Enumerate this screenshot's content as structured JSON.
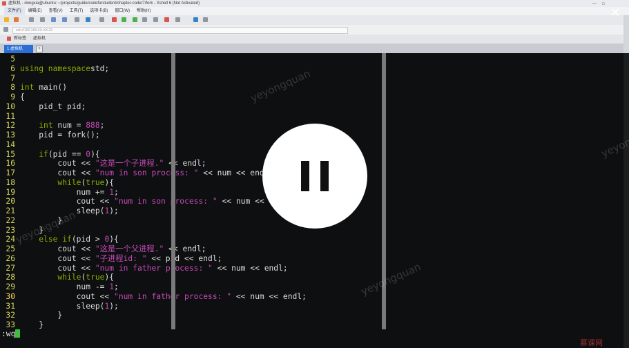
{
  "window": {
    "title": "虚拟机 - dongxia@ubuntu: ~/projects/guide/codeforstudent/chapter-code/7/fork - Xshell 6 (Not Activated)"
  },
  "menu": [
    "文件(F)",
    "编辑(E)",
    "查看(V)",
    "工具(T)",
    "选项卡(B)",
    "窗口(W)",
    "帮助(H)"
  ],
  "address": {
    "text": "ssh://192.168.XX.XX:22"
  },
  "session_bar": {
    "item1": "新标签",
    "item2": "虚拟机"
  },
  "tabs": {
    "active_label": "1 虚拟机",
    "add_label": "+"
  },
  "close": {
    "glyph": "✕"
  },
  "editor": {
    "lines": [
      {
        "n": "5",
        "c": []
      },
      {
        "n": "6",
        "c": [
          [
            "kw",
            "using namespace"
          ],
          [
            "",
            "std;"
          ]
        ]
      },
      {
        "n": "7",
        "c": []
      },
      {
        "n": "8",
        "c": [
          [
            "kw",
            "int"
          ],
          [
            "",
            " main()"
          ]
        ]
      },
      {
        "n": "9",
        "c": [
          [
            "",
            "{"
          ]
        ]
      },
      {
        "n": "10",
        "c": [
          [
            "",
            "    pid_t pid;"
          ]
        ]
      },
      {
        "n": "11",
        "c": []
      },
      {
        "n": "12",
        "c": [
          [
            "",
            "    "
          ],
          [
            "kw",
            "int"
          ],
          [
            "",
            " num = "
          ],
          [
            "num",
            "888"
          ],
          [
            "",
            ";"
          ]
        ]
      },
      {
        "n": "13",
        "c": [
          [
            "",
            "    pid = fork();"
          ]
        ]
      },
      {
        "n": "14",
        "c": []
      },
      {
        "n": "15",
        "c": [
          [
            "",
            "    "
          ],
          [
            "kw",
            "if"
          ],
          [
            "",
            "(pid == "
          ],
          [
            "num",
            "0"
          ],
          [
            "",
            "){"
          ]
        ]
      },
      {
        "n": "16",
        "c": [
          [
            "",
            "        cout << "
          ],
          [
            "st",
            "\"这是一个子进程.\""
          ],
          [
            "",
            " << endl;"
          ]
        ]
      },
      {
        "n": "17",
        "c": [
          [
            "",
            "        cout << "
          ],
          [
            "st",
            "\"num in son process: \""
          ],
          [
            "",
            " << num << endl;"
          ]
        ]
      },
      {
        "n": "18",
        "c": [
          [
            "",
            "        "
          ],
          [
            "kw",
            "while"
          ],
          [
            "",
            "("
          ],
          [
            "kw",
            "true"
          ],
          [
            "",
            "){"
          ]
        ]
      },
      {
        "n": "19",
        "c": [
          [
            "",
            "            num += "
          ],
          [
            "num",
            "1"
          ],
          [
            "",
            ";"
          ]
        ]
      },
      {
        "n": "20",
        "c": [
          [
            "",
            "            cout << "
          ],
          [
            "st",
            "\"num in son process: \""
          ],
          [
            "",
            " << num << endl;"
          ]
        ]
      },
      {
        "n": "21",
        "c": [
          [
            "",
            "            sleep("
          ],
          [
            "num",
            "1"
          ],
          [
            "",
            ");"
          ]
        ]
      },
      {
        "n": "22",
        "c": [
          [
            "",
            "        }"
          ]
        ]
      },
      {
        "n": "23",
        "c": [
          [
            "",
            "    }"
          ]
        ]
      },
      {
        "n": "24",
        "c": [
          [
            "",
            "    "
          ],
          [
            "kw",
            "else if"
          ],
          [
            "",
            "(pid > "
          ],
          [
            "num",
            "0"
          ],
          [
            "",
            "){"
          ]
        ]
      },
      {
        "n": "25",
        "c": [
          [
            "",
            "        cout << "
          ],
          [
            "st",
            "\"这是一个父进程.\""
          ],
          [
            "",
            " << endl;"
          ]
        ]
      },
      {
        "n": "26",
        "c": [
          [
            "",
            "        cout << "
          ],
          [
            "st",
            "\"子进程id: \""
          ],
          [
            "",
            " << pid << endl;"
          ]
        ]
      },
      {
        "n": "27",
        "c": [
          [
            "",
            "        cout << "
          ],
          [
            "st",
            "\"num in father process: \""
          ],
          [
            "",
            " << num << endl;"
          ]
        ]
      },
      {
        "n": "28",
        "c": [
          [
            "",
            "        "
          ],
          [
            "kw",
            "while"
          ],
          [
            "",
            "("
          ],
          [
            "kw",
            "true"
          ],
          [
            "",
            "){"
          ]
        ]
      },
      {
        "n": "29",
        "c": [
          [
            "",
            "            num -= "
          ],
          [
            "num",
            "1"
          ],
          [
            "",
            ";"
          ]
        ]
      },
      {
        "n": "30",
        "c": [
          [
            "",
            "            cout << "
          ],
          [
            "st",
            "\"num in father process: \""
          ],
          [
            "",
            " << num << endl;"
          ]
        ]
      },
      {
        "n": "31",
        "c": [
          [
            "",
            "            sleep("
          ],
          [
            "num",
            "1"
          ],
          [
            "",
            ");"
          ]
        ]
      },
      {
        "n": "32",
        "c": [
          [
            "",
            "        }"
          ]
        ]
      },
      {
        "n": "33",
        "c": [
          [
            "",
            "    }"
          ]
        ]
      }
    ],
    "current_line": "30",
    "command": ":wq"
  },
  "watermark": "yeyongquan",
  "brand": "慕课网",
  "colors": {
    "keyword": "#87af00",
    "string": "#c54ab9",
    "line_number": "#d7d75f",
    "cursor": "#3fbf3f",
    "tab_active": "#2b6fd6"
  },
  "icons": [
    "pause-icon",
    "close-icon"
  ]
}
